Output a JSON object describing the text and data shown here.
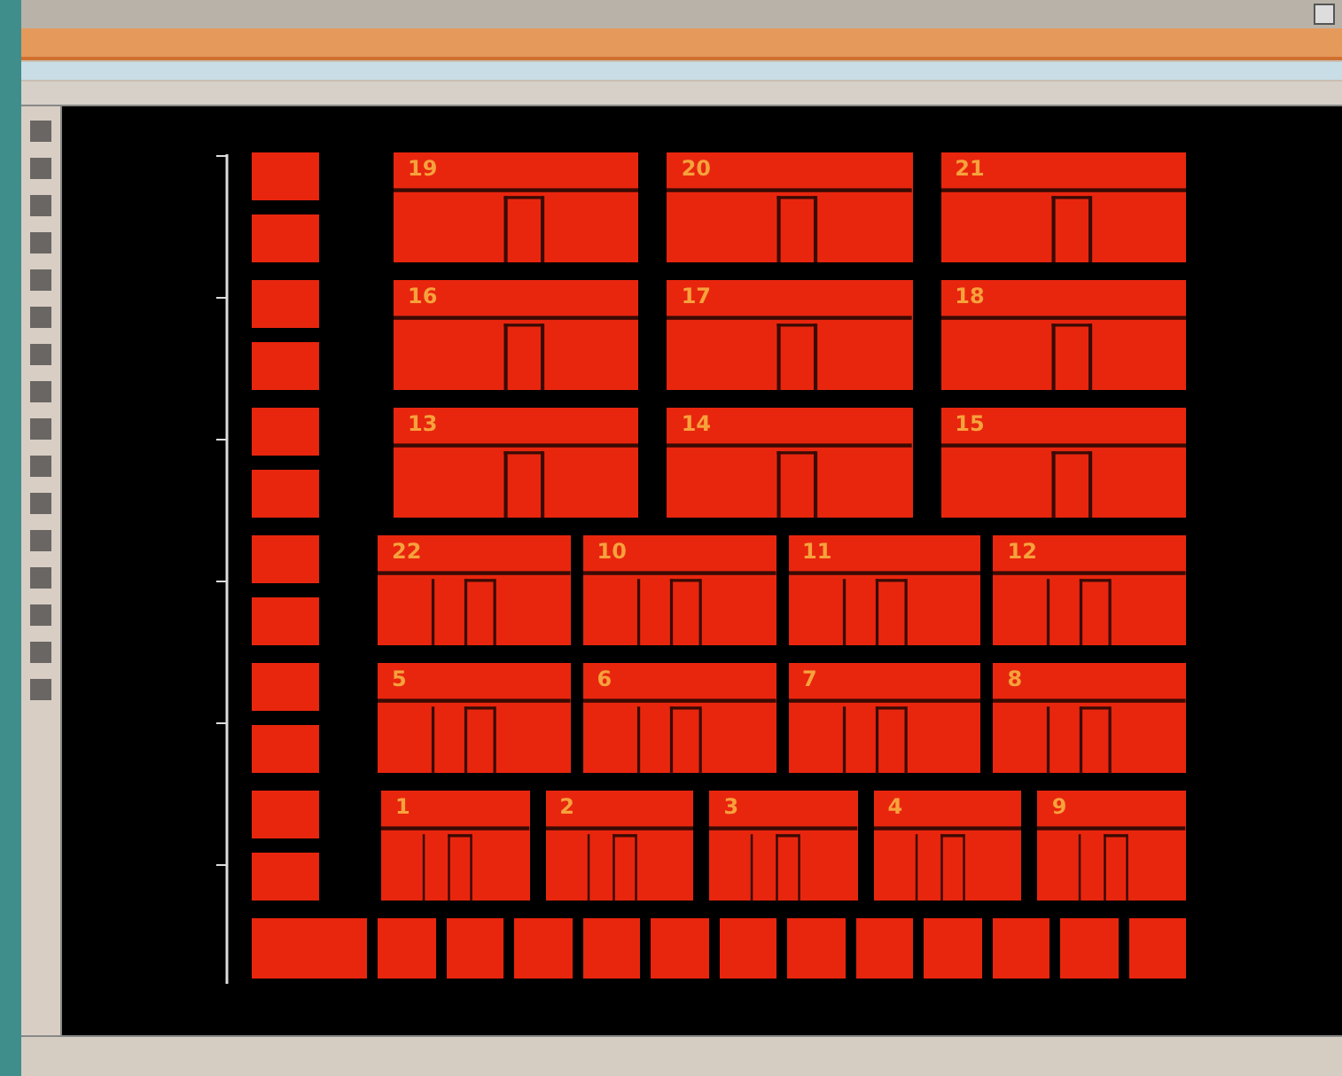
{
  "canvas": {
    "block_rows": [
      {
        "blocks": [
          {
            "label": "19"
          },
          {
            "label": "20"
          },
          {
            "label": "21"
          }
        ]
      },
      {
        "blocks": [
          {
            "label": "16"
          },
          {
            "label": "17"
          },
          {
            "label": "18"
          }
        ]
      },
      {
        "blocks": [
          {
            "label": "13"
          },
          {
            "label": "14"
          },
          {
            "label": "15"
          }
        ]
      },
      {
        "blocks": [
          {
            "label": "22"
          },
          {
            "label": "10"
          },
          {
            "label": "11"
          },
          {
            "label": "12"
          }
        ]
      },
      {
        "blocks": [
          {
            "label": "5"
          },
          {
            "label": "6"
          },
          {
            "label": "7"
          },
          {
            "label": "8"
          }
        ]
      },
      {
        "blocks": [
          {
            "label": "1"
          },
          {
            "label": "2"
          },
          {
            "label": "3"
          },
          {
            "label": "4"
          },
          {
            "label": "9"
          }
        ]
      }
    ]
  }
}
